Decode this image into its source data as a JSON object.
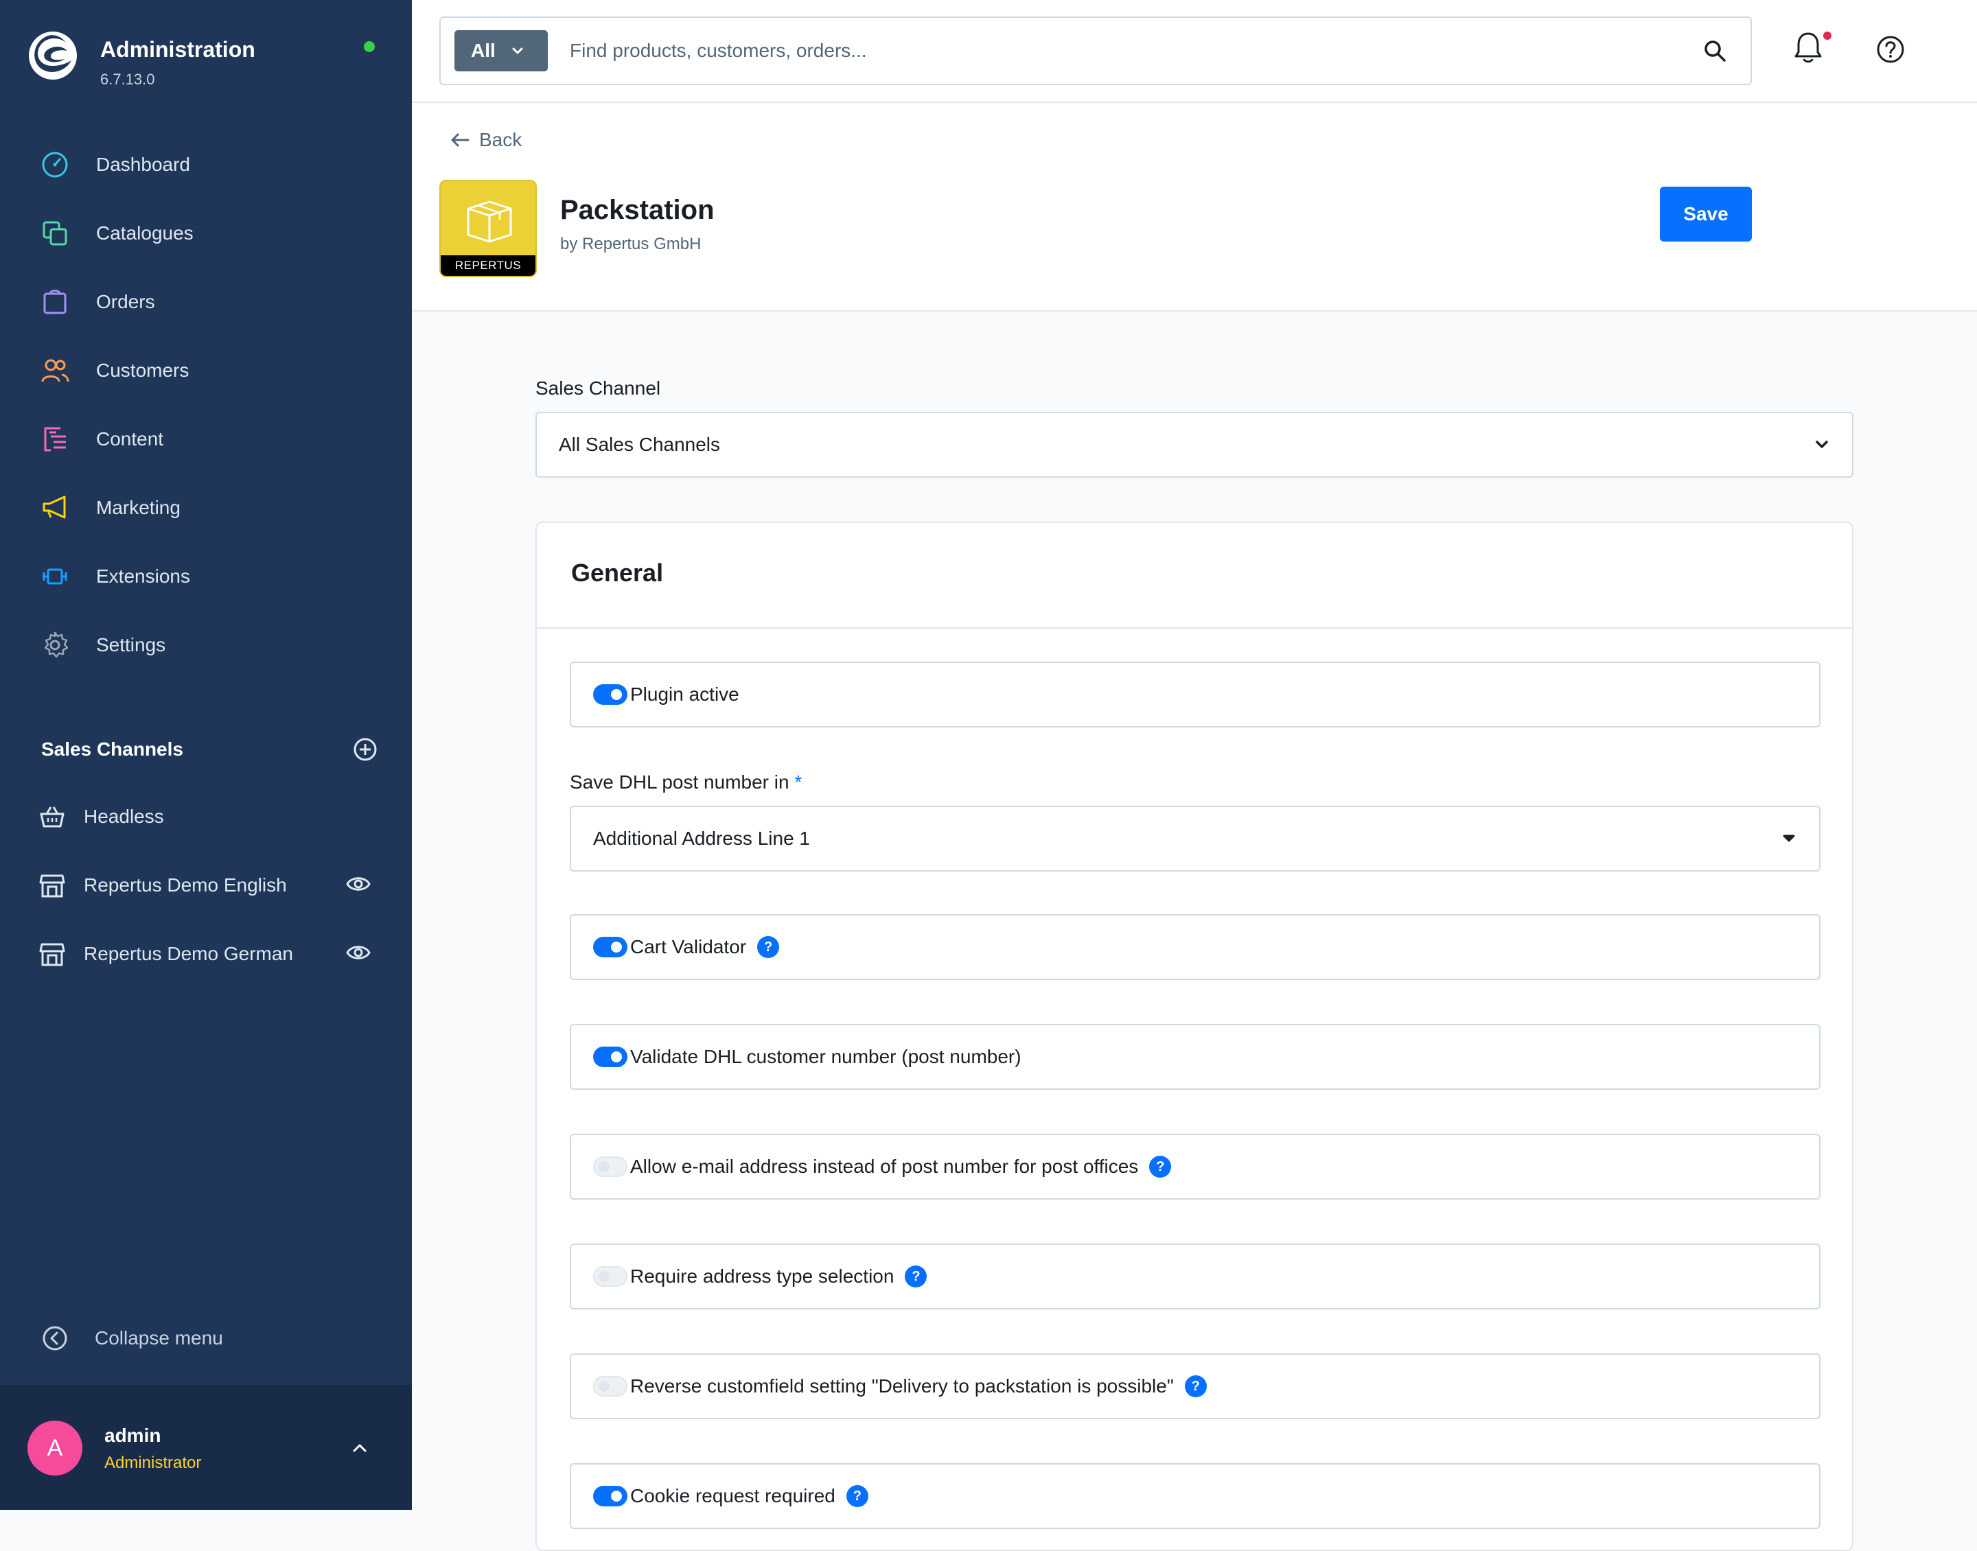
{
  "app": {
    "title": "Administration",
    "version": "6.7.13.0",
    "colors": {
      "sidebar": "#1f3658",
      "accent": "#0870ff",
      "status": "#37d046"
    }
  },
  "sidebar": {
    "nav": [
      {
        "label": "Dashboard",
        "icon": "dashboard-icon",
        "color": "#3bc4e8"
      },
      {
        "label": "Catalogues",
        "icon": "catalogues-icon",
        "color": "#57d9a3"
      },
      {
        "label": "Orders",
        "icon": "orders-icon",
        "color": "#a092f0"
      },
      {
        "label": "Customers",
        "icon": "customers-icon",
        "color": "#ff9c54"
      },
      {
        "label": "Content",
        "icon": "content-icon",
        "color": "#ff68b4"
      },
      {
        "label": "Marketing",
        "icon": "marketing-icon",
        "color": "#ffd700"
      },
      {
        "label": "Extensions",
        "icon": "extensions-icon",
        "color": "#189eff"
      },
      {
        "label": "Settings",
        "icon": "settings-icon",
        "color": "#9aa8b5"
      }
    ],
    "sales_channels_title": "Sales Channels",
    "sales_channels": [
      {
        "label": "Headless",
        "icon": "basket-icon"
      },
      {
        "label": "Repertus Demo English",
        "icon": "storefront-icon"
      },
      {
        "label": "Repertus Demo German",
        "icon": "storefront-icon"
      }
    ],
    "collapse_label": "Collapse menu",
    "user": {
      "initial": "A",
      "name": "admin",
      "role": "Administrator"
    }
  },
  "search": {
    "type_label": "All",
    "placeholder": "Find products, customers, orders..."
  },
  "header": {
    "back_label": "Back",
    "plugin_name": "Packstation",
    "plugin_vendor": "by Repertus GmbH",
    "plugin_icon_label": "REPERTUS",
    "save_label": "Save"
  },
  "form": {
    "sales_channel_label": "Sales Channel",
    "sales_channel_value": "All Sales Channels",
    "card_title": "General",
    "plugin_active": {
      "label": "Plugin active",
      "checked": true
    },
    "post_number_label": "Save DHL post number in",
    "post_number_required": "*",
    "post_number_value": "Additional Address Line 1",
    "options": [
      {
        "label": "Cart Validator",
        "checked": true,
        "help": true
      },
      {
        "label": "Validate DHL customer number (post number)",
        "checked": true,
        "help": false
      },
      {
        "label": "Allow e-mail address instead of post number for post offices",
        "checked": false,
        "help": true
      },
      {
        "label": "Require address type selection",
        "checked": false,
        "help": true
      },
      {
        "label": "Reverse customfield setting \"Delivery to packstation is possible\"",
        "checked": false,
        "help": true
      },
      {
        "label": "Cookie request required",
        "checked": true,
        "help": true
      }
    ],
    "help_glyph": "?"
  }
}
